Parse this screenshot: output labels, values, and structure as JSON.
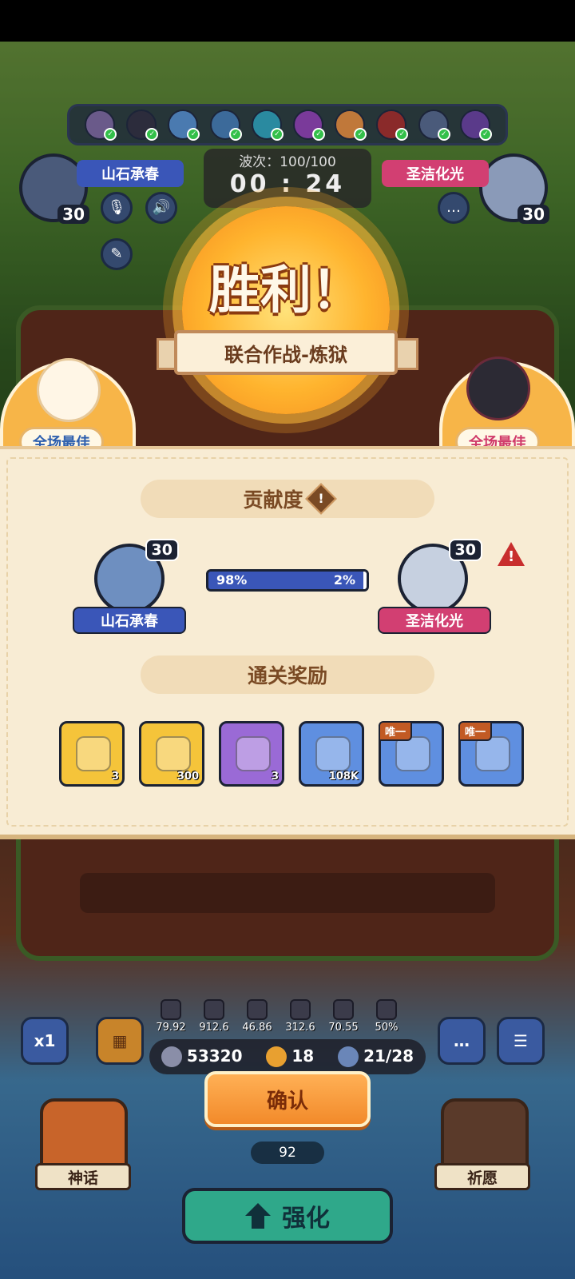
{
  "hud": {
    "wave_label": "波次：100/100",
    "timer": "00 : 24",
    "player_left": {
      "name": "山石承春",
      "level": "30"
    },
    "player_right": {
      "name": "圣洁化光",
      "level": "30"
    }
  },
  "victory": {
    "title": "胜利！",
    "mode": "联合作战-炼狱"
  },
  "best": {
    "left_label": "全场最佳",
    "right_label": "全场最佳"
  },
  "contribution": {
    "title": "贡献度",
    "info_icon": "!",
    "left": {
      "name": "山石承春",
      "level": "30",
      "percent_label": "98%",
      "percent": 0.98,
      "color": "#3a56b8"
    },
    "right": {
      "name": "圣洁化光",
      "level": "30",
      "percent_label": "2%",
      "percent": 0.02,
      "color": "#d23f72"
    },
    "warning_icon": "!"
  },
  "rewards": {
    "title": "通关奖励",
    "items": [
      {
        "icon": "gold-chest-icon",
        "count": "3",
        "bg": "#f5c43a",
        "unique": ""
      },
      {
        "icon": "gold-key-icon",
        "count": "300",
        "bg": "#f5c43a",
        "unique": ""
      },
      {
        "icon": "purple-chest-icon",
        "count": "3",
        "bg": "#9a6ad6",
        "unique": ""
      },
      {
        "icon": "gold-coin-icon",
        "count": "108K",
        "bg": "#5f8fe0",
        "unique": ""
      },
      {
        "icon": "trident-emblem-icon",
        "count": "",
        "bg": "#5f8fe0",
        "unique": "唯一"
      },
      {
        "icon": "blue-emblem-icon",
        "count": "",
        "bg": "#5f8fe0",
        "unique": "唯一"
      }
    ]
  },
  "stats": [
    "79.92",
    "912.6",
    "46.86",
    "312.6",
    "70.55",
    "50%"
  ],
  "resources": {
    "coins": "53320",
    "clovers": "18",
    "slots": "21/28"
  },
  "buttons": {
    "speed": "x1",
    "confirm": "确认",
    "counter": "92",
    "myth": "神话",
    "wish": "祈愿",
    "upgrade": "强化"
  }
}
